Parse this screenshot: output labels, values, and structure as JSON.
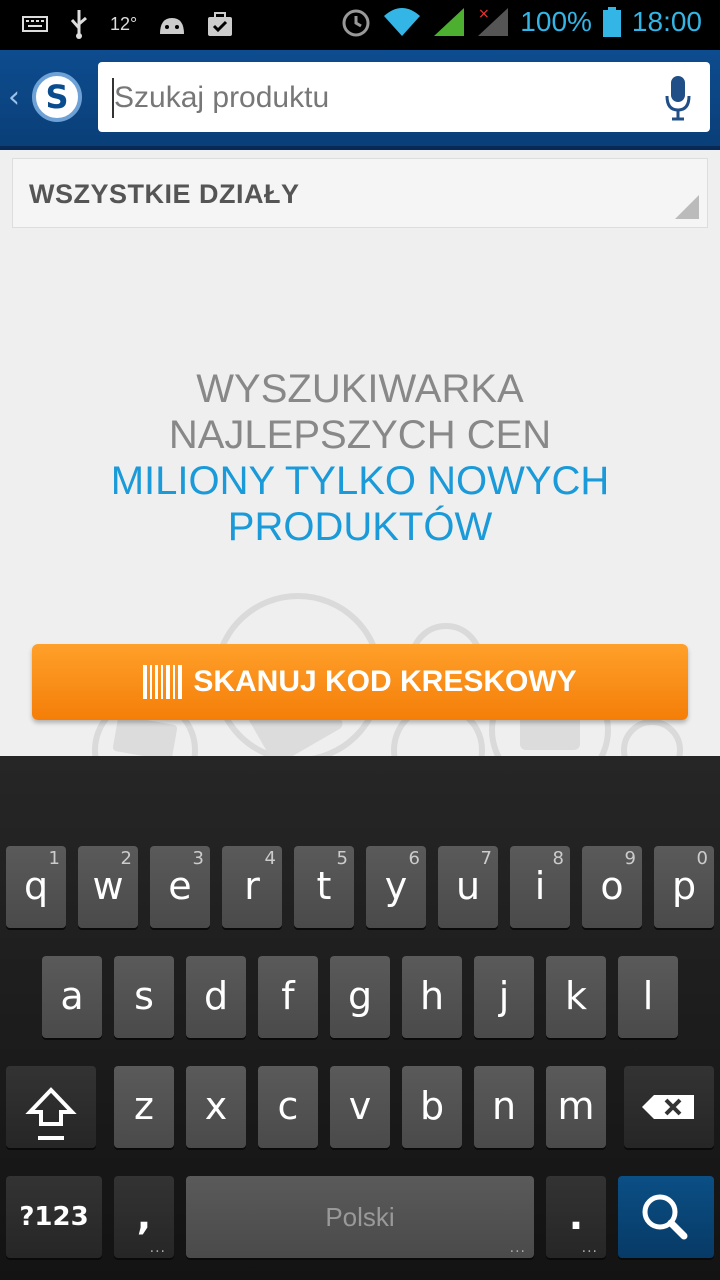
{
  "status_bar": {
    "temperature": "12°",
    "battery": "100%",
    "time": "18:00"
  },
  "action_bar": {
    "logo_letter": "S",
    "search_placeholder": "Szukaj produktu"
  },
  "department": {
    "label": "WSZYSTKIE DZIAŁY"
  },
  "headline": {
    "line1": "WYSZUKIWARKA",
    "line2": "NAJLEPSZYCH CEN",
    "line3": "MILIONY TYLKO NOWYCH",
    "line4": "PRODUKTÓW"
  },
  "scan_button": {
    "label": "SKANUJ KOD KRESKOWY"
  },
  "keyboard": {
    "row1": [
      {
        "key": "q",
        "num": "1"
      },
      {
        "key": "w",
        "num": "2"
      },
      {
        "key": "e",
        "num": "3"
      },
      {
        "key": "r",
        "num": "4"
      },
      {
        "key": "t",
        "num": "5"
      },
      {
        "key": "y",
        "num": "6"
      },
      {
        "key": "u",
        "num": "7"
      },
      {
        "key": "i",
        "num": "8"
      },
      {
        "key": "o",
        "num": "9"
      },
      {
        "key": "p",
        "num": "0"
      }
    ],
    "row2": [
      "a",
      "s",
      "d",
      "f",
      "g",
      "h",
      "j",
      "k",
      "l"
    ],
    "row3": [
      "z",
      "x",
      "c",
      "v",
      "b",
      "n",
      "m"
    ],
    "symbols_label": "?123",
    "comma": ",",
    "space_label": "Polski",
    "period": "."
  },
  "colors": {
    "accent_blue": "#1a9ad8",
    "scan_orange": "#f47e08",
    "actionbar_blue": "#0d4c8f"
  }
}
